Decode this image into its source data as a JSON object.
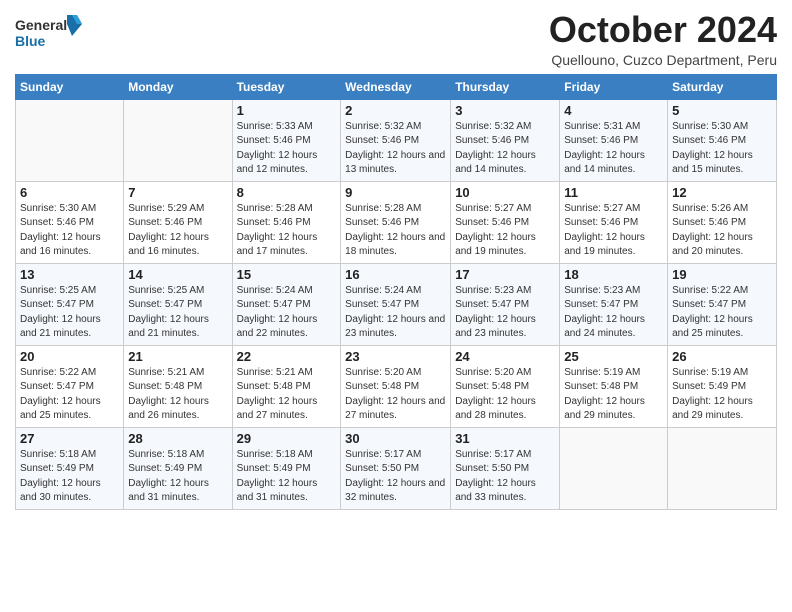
{
  "header": {
    "title": "October 2024",
    "location": "Quellouno, Cuzco Department, Peru"
  },
  "calendar": {
    "days": [
      "Sunday",
      "Monday",
      "Tuesday",
      "Wednesday",
      "Thursday",
      "Friday",
      "Saturday"
    ],
    "weeks": [
      [
        {
          "day": "",
          "sunrise": "",
          "sunset": "",
          "daylight": ""
        },
        {
          "day": "",
          "sunrise": "",
          "sunset": "",
          "daylight": ""
        },
        {
          "day": "1",
          "sunrise": "Sunrise: 5:33 AM",
          "sunset": "Sunset: 5:46 PM",
          "daylight": "Daylight: 12 hours and 12 minutes."
        },
        {
          "day": "2",
          "sunrise": "Sunrise: 5:32 AM",
          "sunset": "Sunset: 5:46 PM",
          "daylight": "Daylight: 12 hours and 13 minutes."
        },
        {
          "day": "3",
          "sunrise": "Sunrise: 5:32 AM",
          "sunset": "Sunset: 5:46 PM",
          "daylight": "Daylight: 12 hours and 14 minutes."
        },
        {
          "day": "4",
          "sunrise": "Sunrise: 5:31 AM",
          "sunset": "Sunset: 5:46 PM",
          "daylight": "Daylight: 12 hours and 14 minutes."
        },
        {
          "day": "5",
          "sunrise": "Sunrise: 5:30 AM",
          "sunset": "Sunset: 5:46 PM",
          "daylight": "Daylight: 12 hours and 15 minutes."
        }
      ],
      [
        {
          "day": "6",
          "sunrise": "Sunrise: 5:30 AM",
          "sunset": "Sunset: 5:46 PM",
          "daylight": "Daylight: 12 hours and 16 minutes."
        },
        {
          "day": "7",
          "sunrise": "Sunrise: 5:29 AM",
          "sunset": "Sunset: 5:46 PM",
          "daylight": "Daylight: 12 hours and 16 minutes."
        },
        {
          "day": "8",
          "sunrise": "Sunrise: 5:28 AM",
          "sunset": "Sunset: 5:46 PM",
          "daylight": "Daylight: 12 hours and 17 minutes."
        },
        {
          "day": "9",
          "sunrise": "Sunrise: 5:28 AM",
          "sunset": "Sunset: 5:46 PM",
          "daylight": "Daylight: 12 hours and 18 minutes."
        },
        {
          "day": "10",
          "sunrise": "Sunrise: 5:27 AM",
          "sunset": "Sunset: 5:46 PM",
          "daylight": "Daylight: 12 hours and 19 minutes."
        },
        {
          "day": "11",
          "sunrise": "Sunrise: 5:27 AM",
          "sunset": "Sunset: 5:46 PM",
          "daylight": "Daylight: 12 hours and 19 minutes."
        },
        {
          "day": "12",
          "sunrise": "Sunrise: 5:26 AM",
          "sunset": "Sunset: 5:46 PM",
          "daylight": "Daylight: 12 hours and 20 minutes."
        }
      ],
      [
        {
          "day": "13",
          "sunrise": "Sunrise: 5:25 AM",
          "sunset": "Sunset: 5:47 PM",
          "daylight": "Daylight: 12 hours and 21 minutes."
        },
        {
          "day": "14",
          "sunrise": "Sunrise: 5:25 AM",
          "sunset": "Sunset: 5:47 PM",
          "daylight": "Daylight: 12 hours and 21 minutes."
        },
        {
          "day": "15",
          "sunrise": "Sunrise: 5:24 AM",
          "sunset": "Sunset: 5:47 PM",
          "daylight": "Daylight: 12 hours and 22 minutes."
        },
        {
          "day": "16",
          "sunrise": "Sunrise: 5:24 AM",
          "sunset": "Sunset: 5:47 PM",
          "daylight": "Daylight: 12 hours and 23 minutes."
        },
        {
          "day": "17",
          "sunrise": "Sunrise: 5:23 AM",
          "sunset": "Sunset: 5:47 PM",
          "daylight": "Daylight: 12 hours and 23 minutes."
        },
        {
          "day": "18",
          "sunrise": "Sunrise: 5:23 AM",
          "sunset": "Sunset: 5:47 PM",
          "daylight": "Daylight: 12 hours and 24 minutes."
        },
        {
          "day": "19",
          "sunrise": "Sunrise: 5:22 AM",
          "sunset": "Sunset: 5:47 PM",
          "daylight": "Daylight: 12 hours and 25 minutes."
        }
      ],
      [
        {
          "day": "20",
          "sunrise": "Sunrise: 5:22 AM",
          "sunset": "Sunset: 5:47 PM",
          "daylight": "Daylight: 12 hours and 25 minutes."
        },
        {
          "day": "21",
          "sunrise": "Sunrise: 5:21 AM",
          "sunset": "Sunset: 5:48 PM",
          "daylight": "Daylight: 12 hours and 26 minutes."
        },
        {
          "day": "22",
          "sunrise": "Sunrise: 5:21 AM",
          "sunset": "Sunset: 5:48 PM",
          "daylight": "Daylight: 12 hours and 27 minutes."
        },
        {
          "day": "23",
          "sunrise": "Sunrise: 5:20 AM",
          "sunset": "Sunset: 5:48 PM",
          "daylight": "Daylight: 12 hours and 27 minutes."
        },
        {
          "day": "24",
          "sunrise": "Sunrise: 5:20 AM",
          "sunset": "Sunset: 5:48 PM",
          "daylight": "Daylight: 12 hours and 28 minutes."
        },
        {
          "day": "25",
          "sunrise": "Sunrise: 5:19 AM",
          "sunset": "Sunset: 5:48 PM",
          "daylight": "Daylight: 12 hours and 29 minutes."
        },
        {
          "day": "26",
          "sunrise": "Sunrise: 5:19 AM",
          "sunset": "Sunset: 5:49 PM",
          "daylight": "Daylight: 12 hours and 29 minutes."
        }
      ],
      [
        {
          "day": "27",
          "sunrise": "Sunrise: 5:18 AM",
          "sunset": "Sunset: 5:49 PM",
          "daylight": "Daylight: 12 hours and 30 minutes."
        },
        {
          "day": "28",
          "sunrise": "Sunrise: 5:18 AM",
          "sunset": "Sunset: 5:49 PM",
          "daylight": "Daylight: 12 hours and 31 minutes."
        },
        {
          "day": "29",
          "sunrise": "Sunrise: 5:18 AM",
          "sunset": "Sunset: 5:49 PM",
          "daylight": "Daylight: 12 hours and 31 minutes."
        },
        {
          "day": "30",
          "sunrise": "Sunrise: 5:17 AM",
          "sunset": "Sunset: 5:50 PM",
          "daylight": "Daylight: 12 hours and 32 minutes."
        },
        {
          "day": "31",
          "sunrise": "Sunrise: 5:17 AM",
          "sunset": "Sunset: 5:50 PM",
          "daylight": "Daylight: 12 hours and 33 minutes."
        },
        {
          "day": "",
          "sunrise": "",
          "sunset": "",
          "daylight": ""
        },
        {
          "day": "",
          "sunrise": "",
          "sunset": "",
          "daylight": ""
        }
      ]
    ]
  }
}
